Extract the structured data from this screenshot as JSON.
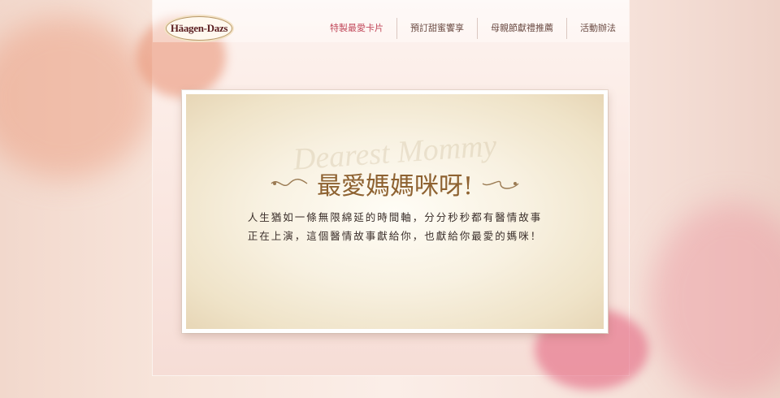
{
  "brand": {
    "logo_text": "Häagen-Dazs"
  },
  "nav": {
    "items": [
      {
        "label": "特製最愛卡片",
        "active": true
      },
      {
        "label": "預訂甜蜜饗享",
        "active": false
      },
      {
        "label": "母親節獻禮推薦",
        "active": false
      },
      {
        "label": "活動辦法",
        "active": false
      }
    ]
  },
  "card": {
    "watermark": "Dearest Mommy",
    "title": "最愛媽媽咪呀!",
    "body_lines": [
      "人生猶如一條無限綿延的時間軸，分分秒秒都有醫情故事",
      "正在上演，這個醫情故事獻給你，也獻給你最愛的媽咪！"
    ]
  },
  "colors": {
    "accent": "#c24a5c",
    "title": "#8e6231",
    "text": "#3a2e2a",
    "card_border": "#ffffff"
  }
}
